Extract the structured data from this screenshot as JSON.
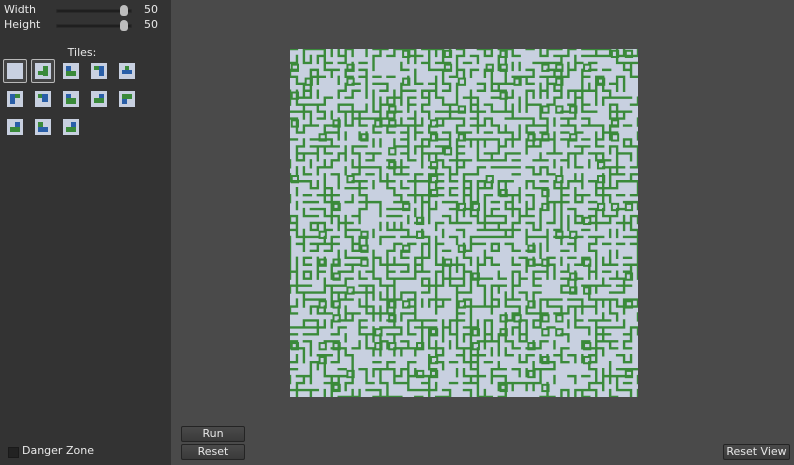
{
  "sidebar": {
    "width_slider": {
      "label": "Width",
      "value": "50",
      "level": 0.9
    },
    "height_slider": {
      "label": "Height",
      "value": "50",
      "level": 0.9
    },
    "tiles_label": "Tiles:",
    "tiles": [
      {
        "name": "tile-blank",
        "selected": true
      },
      {
        "name": "tile-corner-green",
        "selected": true
      },
      {
        "name": "tile-green-1",
        "selected": false
      },
      {
        "name": "tile-blue-1",
        "selected": false
      },
      {
        "name": "tile-blue-2",
        "selected": false
      },
      {
        "name": "tile-blue-3",
        "selected": false
      },
      {
        "name": "tile-green-2",
        "selected": false
      },
      {
        "name": "tile-green-3",
        "selected": false
      },
      {
        "name": "tile-green-4",
        "selected": false
      },
      {
        "name": "tile-green-5",
        "selected": false
      },
      {
        "name": "tile-blue-4",
        "selected": false
      },
      {
        "name": "tile-green-6",
        "selected": false
      },
      {
        "name": "tile-blue-5",
        "selected": false
      }
    ],
    "danger_zone_label": "Danger Zone"
  },
  "buttons": {
    "run_label": "Run",
    "reset_label": "Reset",
    "reset_view_label": "Reset View"
  },
  "output": {
    "grid_cols": 50,
    "grid_rows": 50,
    "colors": {
      "background": "#c8d0e0",
      "stroke": "#3a8a3a"
    }
  },
  "colors": {
    "app_background": "#4a4a4a",
    "sidebar_background": "#333333",
    "tile_light": "#c8d0e0",
    "tile_green": "#3a8a3a",
    "tile_blue": "#2a5fa8"
  }
}
